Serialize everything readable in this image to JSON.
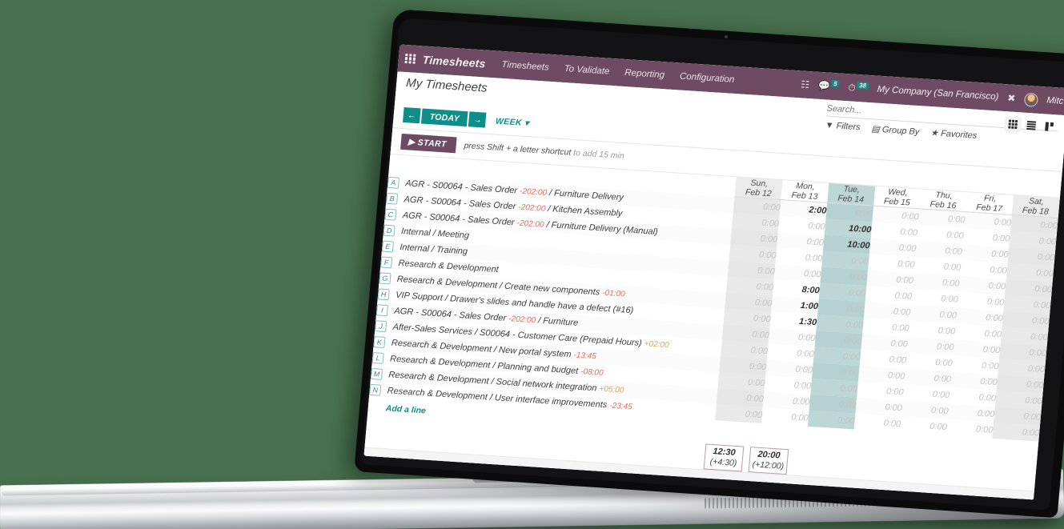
{
  "theme": {
    "desktop_bg": "#48714f",
    "navbar_bg": "#6e4b63",
    "accent_teal": "#0e8e89",
    "today_col": "#bdd6d6",
    "negative": "#e06c5a",
    "positive": "#e0a05a"
  },
  "navbar": {
    "apps_icon": "apps-grid-icon",
    "brand": "Timesheets",
    "menu": [
      {
        "label": "Timesheets"
      },
      {
        "label": "To Validate"
      },
      {
        "label": "Reporting"
      },
      {
        "label": "Configuration"
      }
    ],
    "right": {
      "phone_icon": "phone-keypad-icon",
      "messages_icon": "chat-bubble-icon",
      "messages_count": "5",
      "activities_icon": "clock-activity-icon",
      "activities_count": "38",
      "company": "My Company (San Francisco)",
      "tools_icon": "wrench-screwdriver-icon",
      "avatar": "user-avatar",
      "username": "Mitc"
    }
  },
  "control_panel": {
    "title": "My Timesheets",
    "search": {
      "placeholder": "Search...",
      "value": ""
    },
    "search_tools": [
      {
        "icon": "filter-icon",
        "label": "Filters"
      },
      {
        "icon": "layers-icon",
        "label": "Group By"
      },
      {
        "icon": "star-icon",
        "label": "Favorites"
      }
    ],
    "views": [
      {
        "icon": "grid-view-icon",
        "active": true
      },
      {
        "icon": "list-view-icon",
        "active": false
      },
      {
        "icon": "kanban-view-icon",
        "active": false
      }
    ],
    "nav": {
      "prev_icon": "arrow-left-icon",
      "today_label": "TODAY",
      "next_icon": "arrow-right-icon",
      "scale_label": "WEEK",
      "scale_caret": "chevron-down-icon"
    }
  },
  "timer_bar": {
    "start_icon": "play-icon",
    "start_label": "START",
    "hint_strong": "press Shift + a letter shortcut",
    "hint_rest": " to add 15 min"
  },
  "grid": {
    "columns": [
      {
        "dow": "Sun,",
        "date": "Feb 12",
        "type": "weekend"
      },
      {
        "dow": "Mon,",
        "date": "Feb 13",
        "type": "normal"
      },
      {
        "dow": "Tue,",
        "date": "Feb 14",
        "type": "today"
      },
      {
        "dow": "Wed,",
        "date": "Feb 15",
        "type": "normal"
      },
      {
        "dow": "Thu,",
        "date": "Feb 16",
        "type": "normal"
      },
      {
        "dow": "Fri,",
        "date": "Feb 17",
        "type": "normal"
      },
      {
        "dow": "Sat,",
        "date": "Feb 18",
        "type": "weekend"
      }
    ],
    "rows": [
      {
        "key": "A",
        "prefix": "AGR - S00064 - Sales Order",
        "delta": "-202:00",
        "delta_sign": "neg",
        "suffix": "/ Furniture Delivery",
        "values": [
          "0:00",
          "2:00",
          "0:00",
          "0:00",
          "0:00",
          "0:00",
          "0:00"
        ]
      },
      {
        "key": "B",
        "prefix": "AGR - S00064 - Sales Order",
        "delta": "-202:00",
        "delta_sign": "neg",
        "suffix": "/ Kitchen Assembly",
        "values": [
          "0:00",
          "0:00",
          "10:00",
          "0:00",
          "0:00",
          "0:00",
          "0:00"
        ]
      },
      {
        "key": "C",
        "prefix": "AGR - S00064 - Sales Order",
        "delta": "-202:00",
        "delta_sign": "neg",
        "suffix": "/ Furniture Delivery (Manual)",
        "values": [
          "0:00",
          "0:00",
          "10:00",
          "0:00",
          "0:00",
          "0:00",
          "0:00"
        ]
      },
      {
        "key": "D",
        "prefix": "Internal / Meeting",
        "delta": "",
        "delta_sign": "",
        "suffix": "",
        "values": [
          "0:00",
          "0:00",
          "0:00",
          "0:00",
          "0:00",
          "0:00",
          "0:00"
        ]
      },
      {
        "key": "E",
        "prefix": "Internal / Training",
        "delta": "",
        "delta_sign": "",
        "suffix": "",
        "values": [
          "0:00",
          "0:00",
          "0:00",
          "0:00",
          "0:00",
          "0:00",
          "0:00"
        ]
      },
      {
        "key": "F",
        "prefix": "Research & Development",
        "delta": "",
        "delta_sign": "",
        "suffix": "",
        "values": [
          "0:00",
          "8:00",
          "0:00",
          "0:00",
          "0:00",
          "0:00",
          "0:00"
        ]
      },
      {
        "key": "G",
        "prefix": "Research & Development / Create new components",
        "delta": "-01:00",
        "delta_sign": "neg",
        "suffix": "",
        "values": [
          "0:00",
          "1:00",
          "0:00",
          "0:00",
          "0:00",
          "0:00",
          "0:00"
        ]
      },
      {
        "key": "H",
        "prefix": "VIP Support / Drawer's slides and handle have a defect (#16)",
        "delta": "",
        "delta_sign": "",
        "suffix": "",
        "values": [
          "0:00",
          "1:30",
          "0:00",
          "0:00",
          "0:00",
          "0:00",
          "0:00"
        ]
      },
      {
        "key": "I",
        "prefix": "AGR - S00064 - Sales Order",
        "delta": "-202:00",
        "delta_sign": "neg",
        "suffix": "/ Furniture",
        "values": [
          "0:00",
          "0:00",
          "0:00",
          "0:00",
          "0:00",
          "0:00",
          "0:00"
        ]
      },
      {
        "key": "J",
        "prefix": "After-Sales Services / S00064 - Customer Care (Prepaid Hours)",
        "delta": "+02:00",
        "delta_sign": "pos",
        "suffix": "",
        "values": [
          "0:00",
          "0:00",
          "0:00",
          "0:00",
          "0:00",
          "0:00",
          "0:00"
        ]
      },
      {
        "key": "K",
        "prefix": "Research & Development / New portal system",
        "delta": "-13:45",
        "delta_sign": "neg",
        "suffix": "",
        "values": [
          "0:00",
          "0:00",
          "0:00",
          "0:00",
          "0:00",
          "0:00",
          "0:00"
        ]
      },
      {
        "key": "L",
        "prefix": "Research & Development / Planning and budget",
        "delta": "-08:00",
        "delta_sign": "neg",
        "suffix": "",
        "values": [
          "0:00",
          "0:00",
          "0:00",
          "0:00",
          "0:00",
          "0:00",
          "0:00"
        ]
      },
      {
        "key": "M",
        "prefix": "Research & Development / Social network integration",
        "delta": "+05:00",
        "delta_sign": "pos",
        "suffix": "",
        "values": [
          "0:00",
          "0:00",
          "0:00",
          "0:00",
          "0:00",
          "0:00",
          "0:00"
        ]
      },
      {
        "key": "N",
        "prefix": "Research & Development / User interface improvements",
        "delta": "-23:45",
        "delta_sign": "neg",
        "suffix": "",
        "values": [
          "0:00",
          "0:00",
          "0:00",
          "0:00",
          "0:00",
          "0:00",
          "0:00"
        ]
      }
    ],
    "add_line_label": "Add a line",
    "totals": [
      {
        "total": "12:30",
        "diff": "(+4:30)"
      },
      {
        "total": "20:00",
        "diff": "(+12:00)"
      }
    ]
  }
}
